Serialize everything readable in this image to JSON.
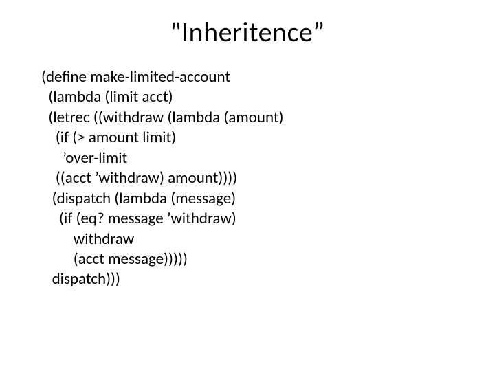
{
  "title": "\"Inheritence”",
  "code": "(define make-limited-account\n  (lambda (limit acct)\n  (letrec ((withdraw (lambda (amount)\n    (if (> amount limit)\n      ’over-limit\n    ((acct ’withdraw) amount))))\n   (dispatch (lambda (message)\n     (if (eq? message ’withdraw)\n         withdraw\n         (acct message)))))\n   dispatch)))"
}
